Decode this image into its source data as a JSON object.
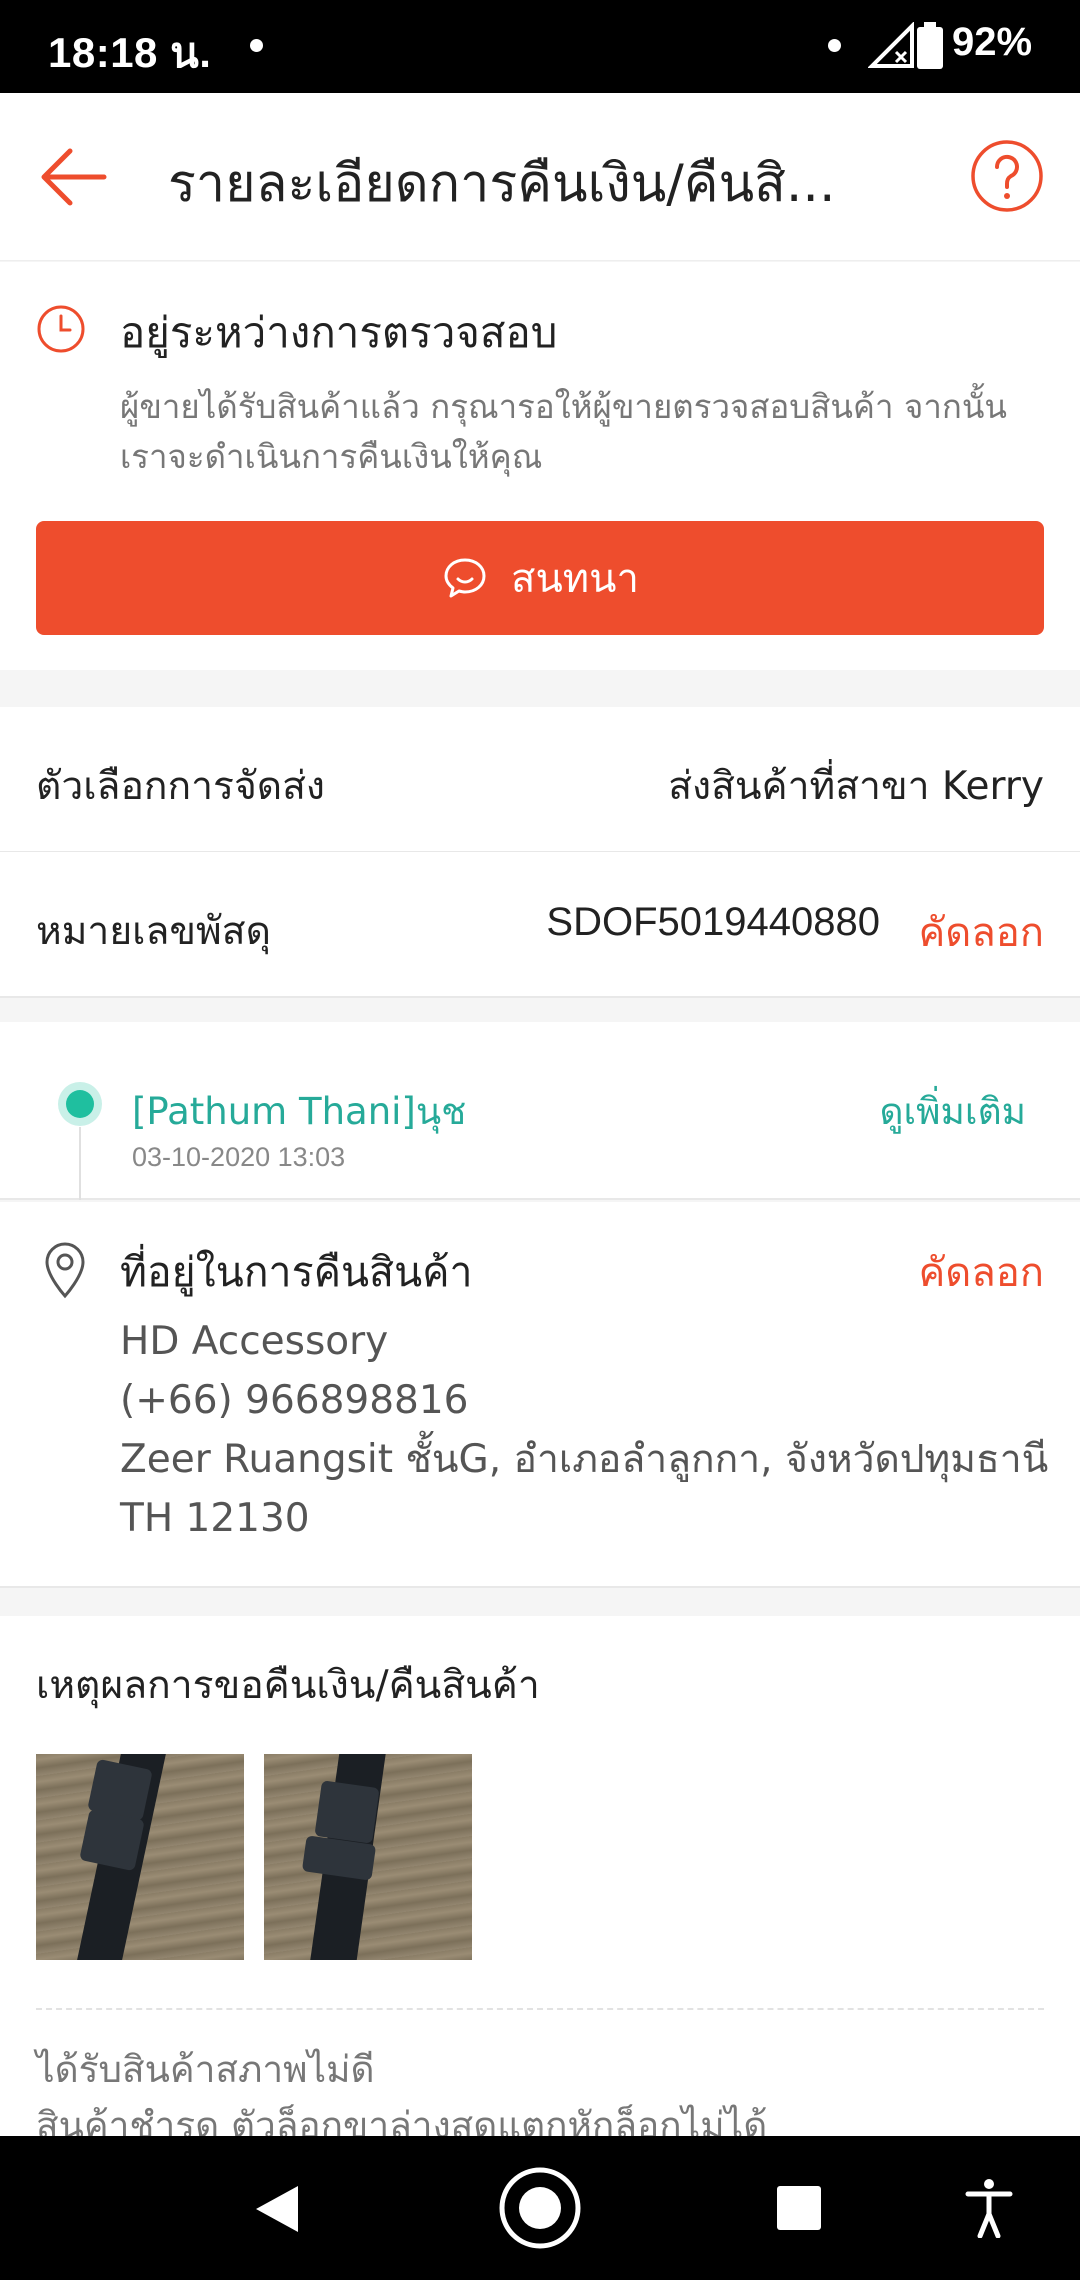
{
  "status_bar": {
    "time": "18:18 น.",
    "battery": "92%"
  },
  "header": {
    "title": "รายละเอียดการคืนเงิน/คืนสิ..."
  },
  "status_card": {
    "title": "อยู่ระหว่างการตรวจสอบ",
    "description": "ผู้ขายได้รับสินค้าแล้ว กรุณารอให้ผู้ขายตรวจสอบสินค้า จากนั้นเราจะดำเนินการคืนเงินให้คุณ",
    "chat_label": "สนทนา"
  },
  "shipping": {
    "label": "ตัวเลือกการจัดส่ง",
    "value": "ส่งสินค้าที่สาขา Kerry"
  },
  "tracking": {
    "label": "หมายเลขพัสดุ",
    "value": "SDOF5019440880",
    "copy_label": "คัดลอก"
  },
  "tracking_event": {
    "text": "[Pathum Thani]นุช",
    "time": "03-10-2020 13:03",
    "more_label": "ดูเพิ่มเติม"
  },
  "return_address": {
    "title": "ที่อยู่ในการคืนสินค้า",
    "copy_label": "คัดลอก",
    "name": "HD Accessory",
    "phone": "(+66) 966898816",
    "line1": "Zeer Ruangsit ชั้นG, อำเภอลำลูกกา, จังหวัดปทุมธานี",
    "line2": "TH 12130"
  },
  "reason": {
    "title": "เหตุผลการขอคืนเงิน/คืนสินค้า",
    "reason_text": "ได้รับสินค้าสภาพไม่ดี",
    "detail_text": "สินค้าชำรุด ตัวล็อกขาล่างสุดแตกหักล็อกไม่ได้"
  },
  "colors": {
    "accent": "#ee4d2d",
    "teal": "#26aa99"
  },
  "icons": [
    "back-arrow-icon",
    "help-icon",
    "clock-icon",
    "chat-icon",
    "location-pin-icon",
    "nav-back-icon",
    "nav-home-icon",
    "nav-recents-icon",
    "accessibility-icon"
  ]
}
